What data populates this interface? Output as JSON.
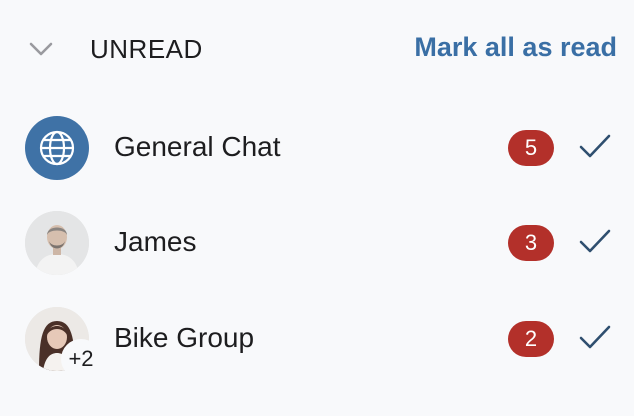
{
  "header": {
    "title": "UNREAD",
    "mark_all_label": "Mark all as read",
    "collapse_icon": "chevron-down-icon"
  },
  "chats": [
    {
      "name": "General Chat",
      "unread": "5",
      "avatar": "globe-icon"
    },
    {
      "name": "James",
      "unread": "3",
      "avatar": "profile-photo"
    },
    {
      "name": "Bike Group",
      "unread": "2",
      "avatar": "profile-photo",
      "extra_members": "+2"
    }
  ],
  "colors": {
    "accent": "#3a6fa5",
    "badge": "#b3302a",
    "globe_bg": "#3f72a6",
    "check": "#2f4f6f",
    "background": "#f8f9fb"
  }
}
